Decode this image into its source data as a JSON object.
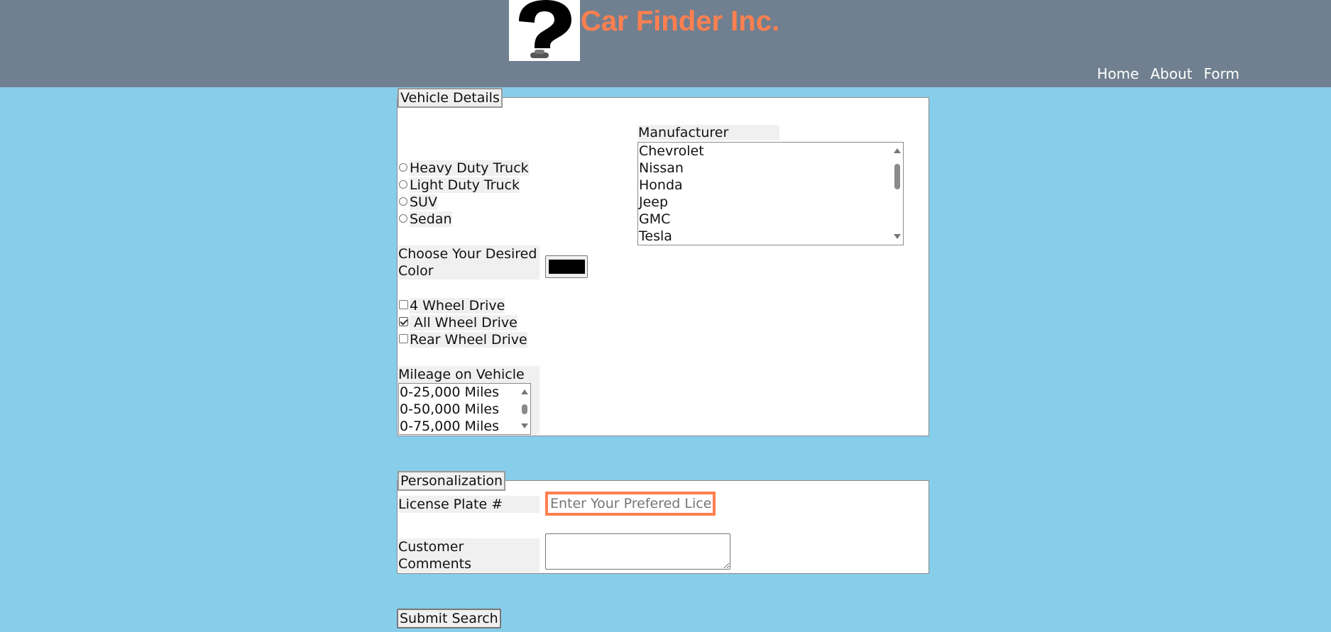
{
  "header": {
    "brand": "Car Finder Inc.",
    "brand_color": "#ff7f50",
    "logo_icon": "question-mark-car-logo",
    "nav": [
      "Home",
      "About",
      "Form"
    ]
  },
  "vehicle_details": {
    "legend": "Vehicle Details",
    "vehicle_types": [
      "Heavy Duty Truck",
      "Light Duty Truck",
      "SUV",
      "Sedan"
    ],
    "color_label": "Choose Your Desired Color",
    "color_value": "#000000",
    "drive_options": [
      {
        "label": "4 Wheel Drive",
        "checked": false
      },
      {
        "label": " All Wheel Drive",
        "checked": true
      },
      {
        "label": "Rear Wheel Drive",
        "checked": false
      }
    ],
    "mileage_label": "Mileage on Vehicle",
    "mileage_options": [
      "0-25,000 Miles",
      "0-50,000 Miles",
      "0-75,000 Miles"
    ],
    "manufacturer_label": "Manufacturer",
    "manufacturers": [
      "Chevrolet",
      "Nissan",
      "Honda",
      "Jeep",
      "GMC",
      "Tesla"
    ]
  },
  "personalization": {
    "legend": "Personalization",
    "plate_label": "License Plate #",
    "plate_placeholder": "Enter Your Prefered License Plate",
    "comments_label": "Customer Comments",
    "comments_value": ""
  },
  "submit_label": "Submit Search"
}
